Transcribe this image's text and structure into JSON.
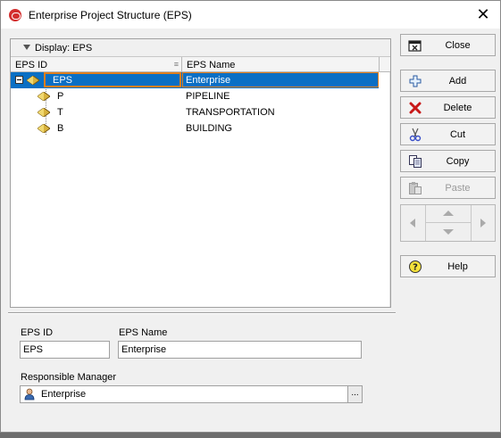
{
  "window": {
    "title": "Enterprise Project Structure (EPS)"
  },
  "tree": {
    "display_label": "Display: EPS",
    "columns": [
      "EPS ID",
      "EPS Name"
    ],
    "rows": [
      {
        "id": "EPS",
        "name": "Enterprise",
        "selected": true,
        "expanded": true
      },
      {
        "id": "P",
        "name": "PIPELINE",
        "selected": false
      },
      {
        "id": "T",
        "name": "TRANSPORTATION",
        "selected": false
      },
      {
        "id": "B",
        "name": "BUILDING",
        "selected": false
      }
    ]
  },
  "details": {
    "eps_id_label": "EPS ID",
    "eps_id_value": "EPS",
    "eps_name_label": "EPS Name",
    "eps_name_value": "Enterprise",
    "manager_label": "Responsible Manager",
    "manager_value": "Enterprise",
    "ellipsis": "..."
  },
  "buttons": {
    "close": "Close",
    "add": "Add",
    "delete": "Delete",
    "cut": "Cut",
    "copy": "Copy",
    "paste": "Paste",
    "help": "Help"
  },
  "colors": {
    "selection": "#0a6fc4",
    "edit_outline": "#e07f1c",
    "node_icon": "#c8a030"
  }
}
